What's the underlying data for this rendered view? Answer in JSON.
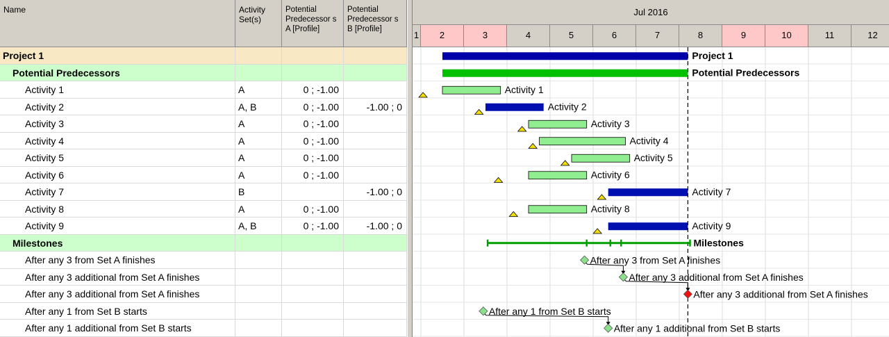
{
  "table": {
    "columns": [
      {
        "label": "Name"
      },
      {
        "label": "Activity Set(s)"
      },
      {
        "label": "Potential Predecessor s A [Profile]"
      },
      {
        "label": "Potential Predecessor s B [Profile]"
      }
    ],
    "rows": [
      {
        "name": "Project 1",
        "sets": "",
        "pred_a": "",
        "pred_b": "",
        "level": 0,
        "kind": "project"
      },
      {
        "name": "Potential Predecessors",
        "sets": "",
        "pred_a": "",
        "pred_b": "",
        "level": 1,
        "kind": "group"
      },
      {
        "name": "Activity 1",
        "sets": "A",
        "pred_a": "0 ; -1.00",
        "pred_b": "",
        "level": 2,
        "kind": "task"
      },
      {
        "name": "Activity 2",
        "sets": "A, B",
        "pred_a": "0 ; -1.00",
        "pred_b": "-1.00 ; 0",
        "level": 2,
        "kind": "task"
      },
      {
        "name": "Activity 3",
        "sets": "A",
        "pred_a": "0 ; -1.00",
        "pred_b": "",
        "level": 2,
        "kind": "task"
      },
      {
        "name": "Activity 4",
        "sets": "A",
        "pred_a": "0 ; -1.00",
        "pred_b": "",
        "level": 2,
        "kind": "task"
      },
      {
        "name": "Activity 5",
        "sets": "A",
        "pred_a": "0 ; -1.00",
        "pred_b": "",
        "level": 2,
        "kind": "task"
      },
      {
        "name": "Activity 6",
        "sets": "A",
        "pred_a": "0 ; -1.00",
        "pred_b": "",
        "level": 2,
        "kind": "task"
      },
      {
        "name": "Activity 7",
        "sets": "B",
        "pred_a": "",
        "pred_b": "-1.00 ; 0",
        "level": 2,
        "kind": "task"
      },
      {
        "name": "Activity 8",
        "sets": "A",
        "pred_a": "0 ; -1.00",
        "pred_b": "",
        "level": 2,
        "kind": "task"
      },
      {
        "name": "Activity 9",
        "sets": "A, B",
        "pred_a": "0 ; -1.00",
        "pred_b": "-1.00 ; 0",
        "level": 2,
        "kind": "task"
      },
      {
        "name": "Milestones",
        "sets": "",
        "pred_a": "",
        "pred_b": "",
        "level": 1,
        "kind": "group"
      },
      {
        "name": "After any 3 from Set A finishes",
        "sets": "",
        "pred_a": "",
        "pred_b": "",
        "level": 2,
        "kind": "milestone"
      },
      {
        "name": "After any 3 additional from Set A finishes",
        "sets": "",
        "pred_a": "",
        "pred_b": "",
        "level": 2,
        "kind": "milestone"
      },
      {
        "name": "After any 3 additional from Set A finishes",
        "sets": "",
        "pred_a": "",
        "pred_b": "",
        "level": 2,
        "kind": "milestone"
      },
      {
        "name": "After any 1 from Set B starts",
        "sets": "",
        "pred_a": "",
        "pred_b": "",
        "level": 2,
        "kind": "milestone"
      },
      {
        "name": "After any 1 additional from Set B starts",
        "sets": "",
        "pred_a": "",
        "pred_b": "",
        "level": 2,
        "kind": "milestone"
      }
    ]
  },
  "gantt": {
    "month_label": "Jul 2016",
    "days": [
      {
        "label": "1",
        "weekend": false
      },
      {
        "label": "2",
        "weekend": true
      },
      {
        "label": "3",
        "weekend": true
      },
      {
        "label": "4",
        "weekend": false
      },
      {
        "label": "5",
        "weekend": false
      },
      {
        "label": "6",
        "weekend": false
      },
      {
        "label": "7",
        "weekend": false
      },
      {
        "label": "8",
        "weekend": false
      },
      {
        "label": "9",
        "weekend": true
      },
      {
        "label": "10",
        "weekend": true
      },
      {
        "label": "11",
        "weekend": false
      },
      {
        "label": "12",
        "weekend": false
      }
    ],
    "status_date": 7.2,
    "bars": [
      {
        "row": 0,
        "start": 1.5,
        "end": 7.2,
        "type": "summary-blue",
        "label": "Project 1",
        "bold": true
      },
      {
        "row": 1,
        "start": 1.5,
        "end": 7.2,
        "type": "summary-green",
        "label": "Potential Predecessors",
        "bold": true
      },
      {
        "row": 2,
        "start": 1.5,
        "end": 2.85,
        "type": "task-light",
        "label": "Activity 1"
      },
      {
        "row": 3,
        "start": 2.5,
        "end": 3.85,
        "type": "task-blue",
        "label": "Activity 2"
      },
      {
        "row": 4,
        "start": 3.5,
        "end": 4.85,
        "type": "task-light",
        "label": "Activity 3"
      },
      {
        "row": 5,
        "start": 3.75,
        "end": 5.75,
        "type": "task-light",
        "label": "Activity 4"
      },
      {
        "row": 6,
        "start": 4.5,
        "end": 5.85,
        "type": "task-light",
        "label": "Activity 5"
      },
      {
        "row": 7,
        "start": 3.5,
        "end": 4.85,
        "type": "task-light",
        "label": "Activity 6"
      },
      {
        "row": 8,
        "start": 5.35,
        "end": 7.2,
        "type": "task-blue",
        "label": "Activity 7"
      },
      {
        "row": 9,
        "start": 3.5,
        "end": 4.85,
        "type": "task-light",
        "label": "Activity 8"
      },
      {
        "row": 10,
        "start": 5.35,
        "end": 7.2,
        "type": "task-blue",
        "label": "Activity 9"
      }
    ],
    "triangles": [
      {
        "row": 2,
        "at": 1.05
      },
      {
        "row": 3,
        "at": 2.35
      },
      {
        "row": 4,
        "at": 3.35
      },
      {
        "row": 5,
        "at": 3.6
      },
      {
        "row": 6,
        "at": 4.35
      },
      {
        "row": 7,
        "at": 2.8
      },
      {
        "row": 8,
        "at": 5.2
      },
      {
        "row": 9,
        "at": 3.15
      },
      {
        "row": 10,
        "at": 5.1
      }
    ],
    "milestone_summary": {
      "row": 11,
      "start": 2.55,
      "end": 7.25,
      "ticks": [
        2.55,
        4.85,
        5.4,
        5.65,
        7.25
      ],
      "label": "Milestones"
    },
    "milestones": [
      {
        "row": 12,
        "at": 4.8,
        "color": "#8be08b",
        "label": "After any 3 from Set A finishes"
      },
      {
        "row": 13,
        "at": 5.7,
        "color": "#8be08b",
        "label": "After any 3 additional from Set A finishes"
      },
      {
        "row": 14,
        "at": 7.2,
        "color": "#ee1111",
        "label": "After any 3 additional from Set A finishes"
      },
      {
        "row": 15,
        "at": 2.45,
        "color": "#8be08b",
        "label": "After any 1 from Set B starts"
      },
      {
        "row": 16,
        "at": 5.35,
        "color": "#8be08b",
        "label": "After any 1 additional from Set B starts"
      }
    ],
    "links": [
      {
        "from_row": 12,
        "from_at": 4.8,
        "to_row": 13,
        "to_at": 5.7
      },
      {
        "from_row": 13,
        "from_at": 5.7,
        "to_row": 14,
        "to_at": 7.2
      },
      {
        "from_row": 15,
        "from_at": 2.45,
        "to_row": 16,
        "to_at": 5.35
      }
    ],
    "colors": {
      "summary_blue": "#0000a8",
      "summary_green": "#00c000",
      "task_light": "#90ee90",
      "task_blue": "#0010b0",
      "triangle": "#f5e000",
      "weekend_header": "#ffc8c8",
      "project_row": "#f9e8c4",
      "group_row": "#ccffcc"
    }
  }
}
